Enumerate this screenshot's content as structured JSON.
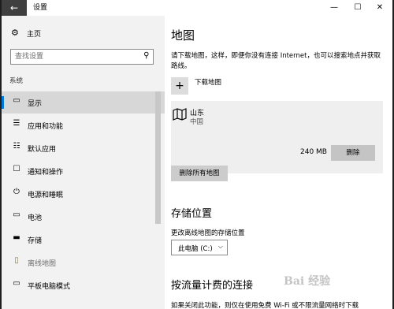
{
  "window": {
    "title": "设置",
    "back_icon": "←",
    "minimize_icon": "—",
    "maximize_icon": "☐",
    "close_icon": "✕"
  },
  "sidebar": {
    "home_icon": "⚙",
    "home_label": "主页",
    "search_placeholder": "查找设置",
    "search_icon": "⚲",
    "section_label": "系统",
    "items": [
      {
        "icon": "▭",
        "label": "显示"
      },
      {
        "icon": "☰",
        "label": "应用和功能"
      },
      {
        "icon": "☷",
        "label": "默认应用"
      },
      {
        "icon": "☐",
        "label": "通知和操作"
      },
      {
        "icon": "⏻",
        "label": "电源和睡眠"
      },
      {
        "icon": "▭",
        "label": "电池"
      },
      {
        "icon": "▬",
        "label": "存储"
      },
      {
        "icon": "▯",
        "label": "离线地图"
      },
      {
        "icon": "▭",
        "label": "平板电脑模式"
      }
    ],
    "selected_index": 0
  },
  "content": {
    "title": "地图",
    "description": "请下载地图，这样，即便你没有连接 Internet，也可以搜索地点并获取路线。",
    "download_icon": "+",
    "download_label": "下载地图",
    "map": {
      "name": "山东",
      "country": "中国",
      "size": "240 MB",
      "delete_label": "删除"
    },
    "delete_all_label": "删除所有地图",
    "storage_heading": "存储位置",
    "storage_label": "更改离线地图的存储位置",
    "storage_value": "此电脑 (C:)",
    "storage_chevron": "⌵",
    "metered_heading": "按流量计费的连接",
    "metered_text": "如果关闭此功能，则仅在使用免费 Wi-Fi 或不限流量网络时下载"
  },
  "watermark": "Bai 经验"
}
